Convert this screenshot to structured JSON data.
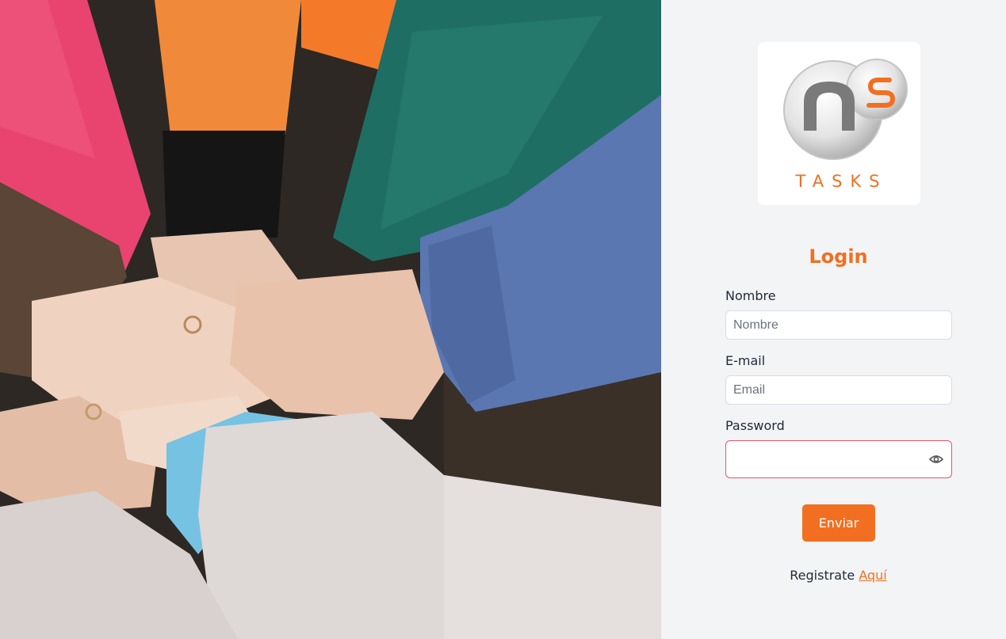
{
  "photo": {
    "alt": "Manos unidas",
    "icon": "hands-together-photo"
  },
  "logo": {
    "word": "TASKS",
    "icon": "ns-logo-icon"
  },
  "login": {
    "title": "Login",
    "name_label": "Nombre",
    "name_placeholder": "Nombre",
    "email_label": "E-mail",
    "email_placeholder": "Email",
    "password_label": "Password",
    "password_placeholder": "",
    "password_toggle_icon": "eye-icon",
    "submit_label": "Enviar"
  },
  "register": {
    "text": "Registrate",
    "link_label": "Aquí"
  },
  "colors": {
    "accent": "#f26f21",
    "panel_bg": "#f3f4f6",
    "error_border": "#e0576a"
  }
}
